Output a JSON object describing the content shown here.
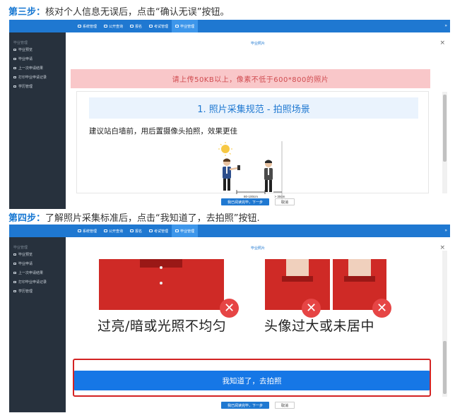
{
  "steps": [
    {
      "label": "第三步：",
      "text": "核对个人信息无误后，点击“确认无误”按钮。"
    },
    {
      "label": "第四步：",
      "text": "了解照片采集标准后，点击“我知道了，去拍照”按钮."
    }
  ],
  "nav": {
    "items": [
      "系统管理",
      "公开查询",
      "报名",
      "考试管理",
      "毕业管理"
    ],
    "active_index": 4,
    "collapse_icon": "double-chevron-right-icon"
  },
  "sidebar": {
    "section": "毕业管理",
    "items": [
      "毕业预览",
      "毕业申请",
      "上一次申请结果",
      "打印毕业申请记录",
      "学历管理"
    ]
  },
  "modal": {
    "title": "毕业照片",
    "close": "×",
    "primary_btn": "我已阅读完毕，下一步",
    "cancel_btn": "取消"
  },
  "step3": {
    "banner": "请上传50KB以上，像素不低于600*800的照片",
    "section_title": "1. 照片采集规范 - 拍照场景",
    "suggestion": "建议站白墙前，用后置摄像头拍照，效果更佳",
    "dist_front": "80-100cm",
    "dist_wall": "> 30cm"
  },
  "step4": {
    "caption_left": "过亮/暗或光照不均匀",
    "caption_right": "头像过大或未居中",
    "x_mark": "✕",
    "main_button": "我知道了，去拍照"
  },
  "colors": {
    "nav_blue": "#1f78d1",
    "sidebar_dark": "#27313d",
    "banner_pink": "#f9c7c9",
    "banner_text": "#d04b50",
    "highlight_red": "#d32323",
    "step_label_blue": "#1677d2"
  }
}
